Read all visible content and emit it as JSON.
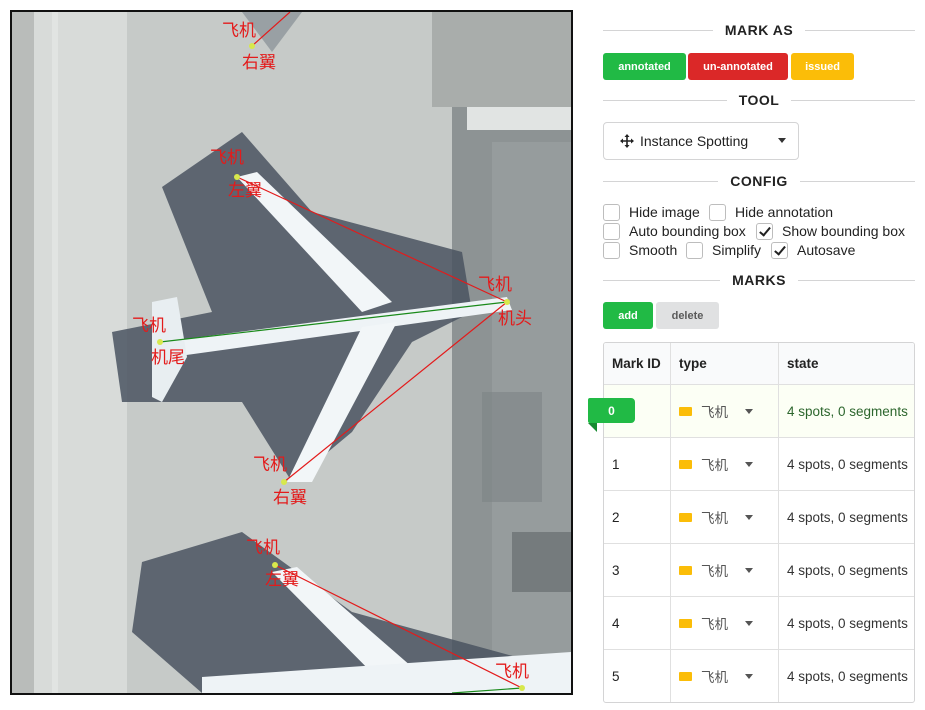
{
  "canvas": {
    "labels": {
      "airplane": "飞机",
      "right_wing": "右翼",
      "left_wing": "左翼",
      "nose": "机头",
      "tail": "机尾"
    }
  },
  "panel": {
    "mark_as": {
      "title": "MARK AS",
      "annotated": "annotated",
      "unannotated": "un-annotated",
      "issued": "issued"
    },
    "tool": {
      "title": "TOOL",
      "selected": "Instance Spotting",
      "icon": "crosshair-move-icon"
    },
    "config": {
      "title": "CONFIG",
      "options": [
        {
          "label": "Hide image",
          "checked": false
        },
        {
          "label": "Hide annotation",
          "checked": false
        },
        {
          "label": "Auto bounding box",
          "checked": false
        },
        {
          "label": "Show bounding box",
          "checked": true
        },
        {
          "label": "Smooth",
          "checked": false
        },
        {
          "label": "Simplify",
          "checked": false
        },
        {
          "label": "Autosave",
          "checked": true
        }
      ]
    },
    "marks": {
      "title": "MARKS",
      "add": "add",
      "delete": "delete",
      "headers": {
        "id": "Mark ID",
        "type": "type",
        "state": "state"
      },
      "active_id": "0",
      "rows": [
        {
          "id": "0",
          "type": "飞机",
          "state": "4 spots, 0 segments"
        },
        {
          "id": "1",
          "type": "飞机",
          "state": "4 spots, 0 segments"
        },
        {
          "id": "2",
          "type": "飞机",
          "state": "4 spots, 0 segments"
        },
        {
          "id": "3",
          "type": "飞机",
          "state": "4 spots, 0 segments"
        },
        {
          "id": "4",
          "type": "飞机",
          "state": "4 spots, 0 segments"
        },
        {
          "id": "5",
          "type": "飞机",
          "state": "4 spots, 0 segments"
        }
      ]
    }
  },
  "colors": {
    "green": "#21ba45",
    "red": "#db2828",
    "yellow": "#fbbd08",
    "annotation_red": "#e31b1b",
    "annotation_green": "#1a8a1a"
  }
}
